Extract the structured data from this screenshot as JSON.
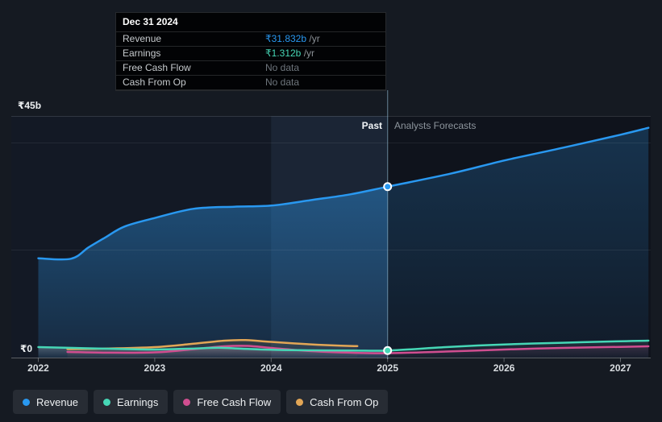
{
  "chart": {
    "past_label": "Past",
    "forecast_label": "Analysts Forecasts",
    "y_top_label": "₹45b",
    "y_zero_label": "₹0"
  },
  "tooltip": {
    "title": "Dec 31 2024",
    "rows": [
      {
        "label": "Revenue",
        "value": "₹31.832b",
        "unit": "/yr",
        "value_color": "#2998f0"
      },
      {
        "label": "Earnings",
        "value": "₹1.312b",
        "unit": "/yr",
        "value_color": "#46d7b6"
      },
      {
        "label": "Free Cash Flow",
        "value": "No data",
        "unit": "",
        "value_color": "#6e757c"
      },
      {
        "label": "Cash From Op",
        "value": "No data",
        "unit": "",
        "value_color": "#6e757c"
      }
    ]
  },
  "chart_data": {
    "type": "line",
    "x_ticks": [
      2022,
      2023,
      2024,
      2025,
      2026,
      2027
    ],
    "y_axis": {
      "min": 0,
      "max": 45,
      "unit": "₹b",
      "top_label": "₹45b",
      "zero_label": "₹0",
      "gridline_values": [
        0,
        20,
        40,
        45
      ]
    },
    "divider_year": 2025,
    "highlight_band": [
      2024,
      2025
    ],
    "legend_position": "bottom",
    "marker": {
      "date": "Dec 31 2024",
      "year": 2025,
      "revenue": 31.832,
      "earnings": 1.312
    },
    "series": [
      {
        "name": "Revenue",
        "color": "#2998f0",
        "x": [
          2022.0,
          2022.28,
          2022.43,
          2022.57,
          2022.74,
          2023.0,
          2023.33,
          2023.68,
          2024.0,
          2024.33,
          2024.68,
          2025.0,
          2025.55,
          2026.0,
          2026.51,
          2027.0,
          2027.24
        ],
        "values": [
          18.5,
          18.4,
          20.5,
          22.3,
          24.4,
          26.0,
          27.7,
          28.1,
          28.3,
          29.3,
          30.4,
          31.832,
          34.3,
          36.7,
          39.1,
          41.5,
          42.8
        ]
      },
      {
        "name": "Earnings",
        "color": "#46d7b6",
        "x": [
          2022.0,
          2022.3,
          2022.6,
          2023.0,
          2023.35,
          2023.55,
          2023.75,
          2024.0,
          2024.35,
          2024.7,
          2025.0,
          2025.5,
          2026.0,
          2026.5,
          2027.0,
          2027.24
        ],
        "values": [
          1.95,
          1.8,
          1.65,
          1.5,
          1.7,
          1.84,
          1.65,
          1.45,
          1.35,
          1.32,
          1.312,
          1.95,
          2.44,
          2.76,
          3.05,
          3.15
        ]
      },
      {
        "name": "Free Cash Flow",
        "color": "#d04e90",
        "x": [
          2022.25,
          2022.6,
          2023.0,
          2023.3,
          2023.6,
          2023.8,
          2024.0,
          2024.35,
          2024.7,
          2025.0,
          2025.5,
          2026.0,
          2026.5,
          2027.0,
          2027.24
        ],
        "values": [
          1.05,
          0.92,
          0.97,
          1.5,
          2.1,
          2.17,
          1.8,
          1.2,
          0.9,
          0.82,
          1.12,
          1.5,
          1.8,
          2.0,
          2.1
        ]
      },
      {
        "name": "Cash From Op",
        "color": "#e2a656",
        "x": [
          2022.25,
          2022.6,
          2023.0,
          2023.3,
          2023.6,
          2023.78,
          2024.0,
          2024.3,
          2024.6,
          2024.74
        ],
        "values": [
          1.57,
          1.68,
          1.95,
          2.5,
          3.15,
          3.25,
          2.92,
          2.5,
          2.2,
          2.13
        ]
      }
    ]
  }
}
